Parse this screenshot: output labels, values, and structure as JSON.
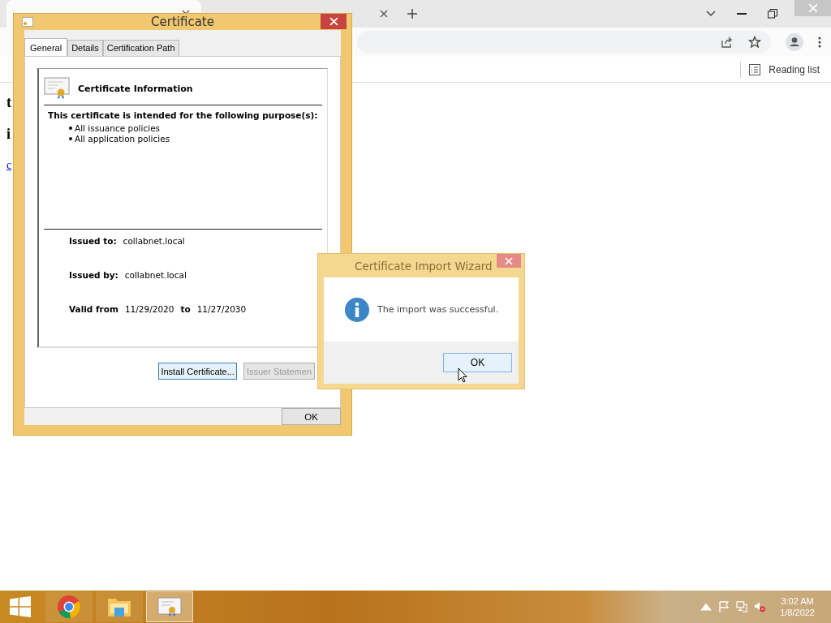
{
  "browser": {
    "tabs": [
      {
        "selected": true
      },
      {
        "selected": false
      }
    ],
    "reading_list": "Reading list"
  },
  "page": {
    "texts": [
      "t",
      "i"
    ],
    "link": "c"
  },
  "certificate_dialog": {
    "title": "Certificate",
    "tabs": [
      {
        "label": "General",
        "selected": true
      },
      {
        "label": "Details",
        "selected": false
      },
      {
        "label": "Certification Path",
        "selected": false
      }
    ],
    "header": "Certificate Information",
    "purpose_heading": "This certificate is intended for the following purpose(s):",
    "purposes": [
      "All issuance policies",
      "All application policies"
    ],
    "fields": [
      {
        "label": "Issued to:",
        "value": "collabnet.local"
      },
      {
        "label": "Issued by:",
        "value": "collabnet.local"
      }
    ],
    "validity": {
      "label": "Valid from",
      "from": "11/29/2020",
      "to_label": "to",
      "to": "11/27/2030"
    },
    "buttons": [
      {
        "label": "Install Certificate...",
        "disabled": false
      },
      {
        "label": "Issuer Statemen",
        "disabled": true
      }
    ],
    "ok": "OK"
  },
  "wizard": {
    "title": "Certificate Import Wizard",
    "message": "The import was successful.",
    "ok": "OK"
  },
  "taskbar": {
    "apps": [
      {
        "kind": "browser",
        "selected": false
      },
      {
        "kind": "folder",
        "selected": false
      },
      {
        "kind": "certificate",
        "selected": true
      }
    ],
    "time": "3:02 AM",
    "date": "1/8/2022"
  }
}
